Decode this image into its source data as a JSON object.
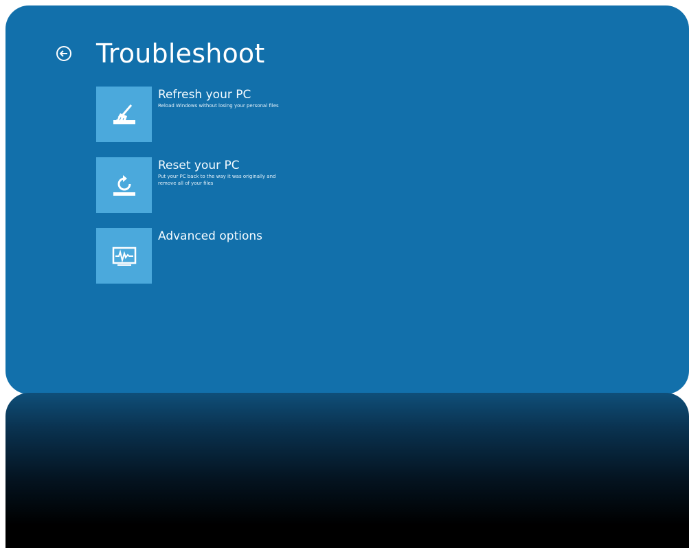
{
  "page": {
    "title": "Troubleshoot",
    "back_icon": "back-arrow-circle-icon"
  },
  "colors": {
    "background": "#1270ab",
    "tile": "#4ba9dc",
    "text": "#ffffff"
  },
  "options": [
    {
      "title": "Refresh your PC",
      "description": "Reload Windows without losing your personal files",
      "icon": "broom-drive-icon"
    },
    {
      "title": "Reset your PC",
      "description": "Put your PC back to the way it was originally and remove all of your files",
      "icon": "reset-drive-icon"
    },
    {
      "title": "Advanced options",
      "description": "",
      "icon": "monitor-waveform-icon"
    }
  ]
}
